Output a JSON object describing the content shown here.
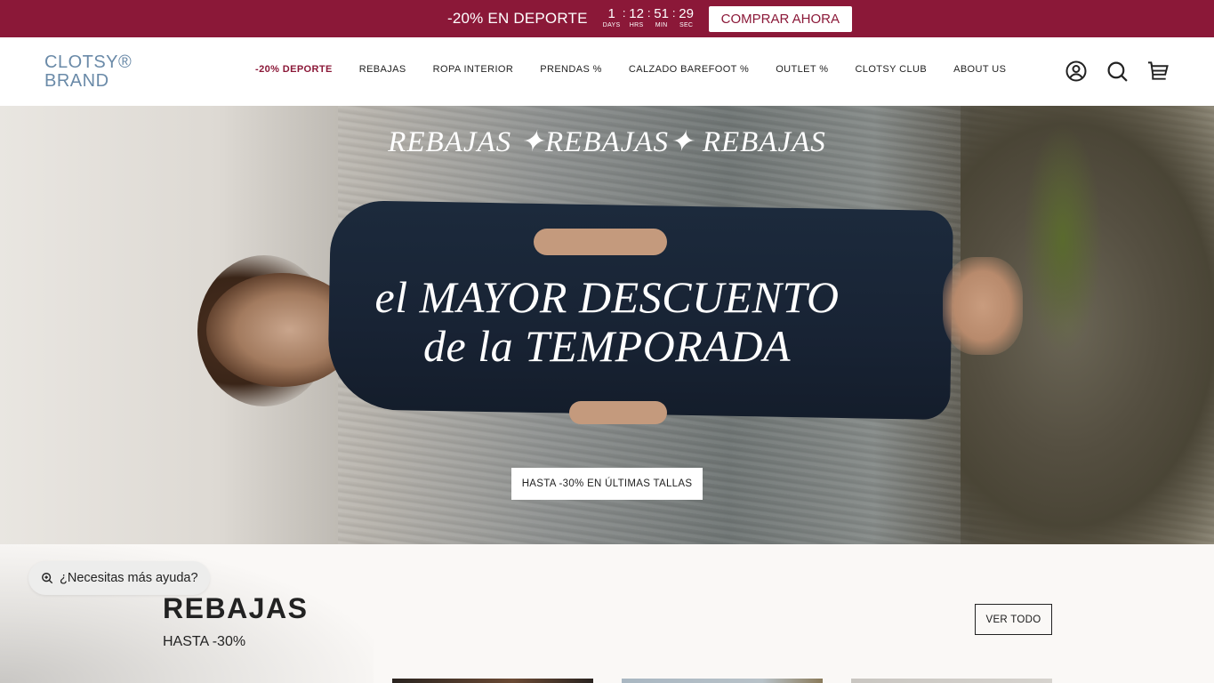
{
  "announcement": {
    "text": "-20% EN DEPORTE",
    "countdown": [
      {
        "value": "1",
        "label": "DAYS"
      },
      {
        "value": "12",
        "label": "HRS"
      },
      {
        "value": "51",
        "label": "MIN"
      },
      {
        "value": "29",
        "label": "SEC"
      }
    ],
    "button": "COMPRAR AHORA",
    "bg_color": "#8b1838"
  },
  "header": {
    "logo_line1": "CLOTSY®",
    "logo_line2": "BRAND",
    "nav": [
      "-20% DEPORTE",
      "REBAJAS",
      "ROPA INTERIOR",
      "PRENDAS %",
      "CALZADO BAREFOOT %",
      "OUTLET %",
      "CLOTSY CLUB",
      "ABOUT US"
    ],
    "icons": [
      "account-icon",
      "search-icon",
      "cart-icon"
    ]
  },
  "hero": {
    "top_text": "REBAJAS ✦REBAJAS✦ REBAJAS",
    "main_line1": "el MAYOR DESCUENTO",
    "main_line2": "de la TEMPORADA",
    "cta": "HASTA -30% EN ÚLTIMAS TALLAS"
  },
  "section": {
    "title": "REBAJAS",
    "subtitle": "HASTA -30%",
    "button": "VER TODO"
  },
  "help_widget": {
    "text": "¿Necesitas más ayuda?"
  }
}
